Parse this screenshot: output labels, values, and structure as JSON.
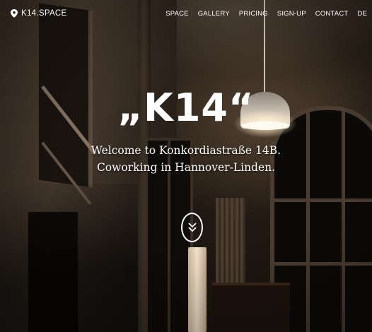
{
  "nav": {
    "brand": "K14.SPACE",
    "items": [
      {
        "label": "SPACE"
      },
      {
        "label": "GALLERY"
      },
      {
        "label": "PRICING"
      },
      {
        "label": "SIGN-UP"
      },
      {
        "label": "CONTACT"
      },
      {
        "label": "DE"
      }
    ]
  },
  "hero": {
    "title": "„K14“",
    "line1": "Welcome to Konkordiastraße 14B.",
    "line2": "Coworking in Hannover-Linden."
  },
  "icons": {
    "brand": "map-pin-icon",
    "scroll": "double-chevron-down-icon"
  }
}
